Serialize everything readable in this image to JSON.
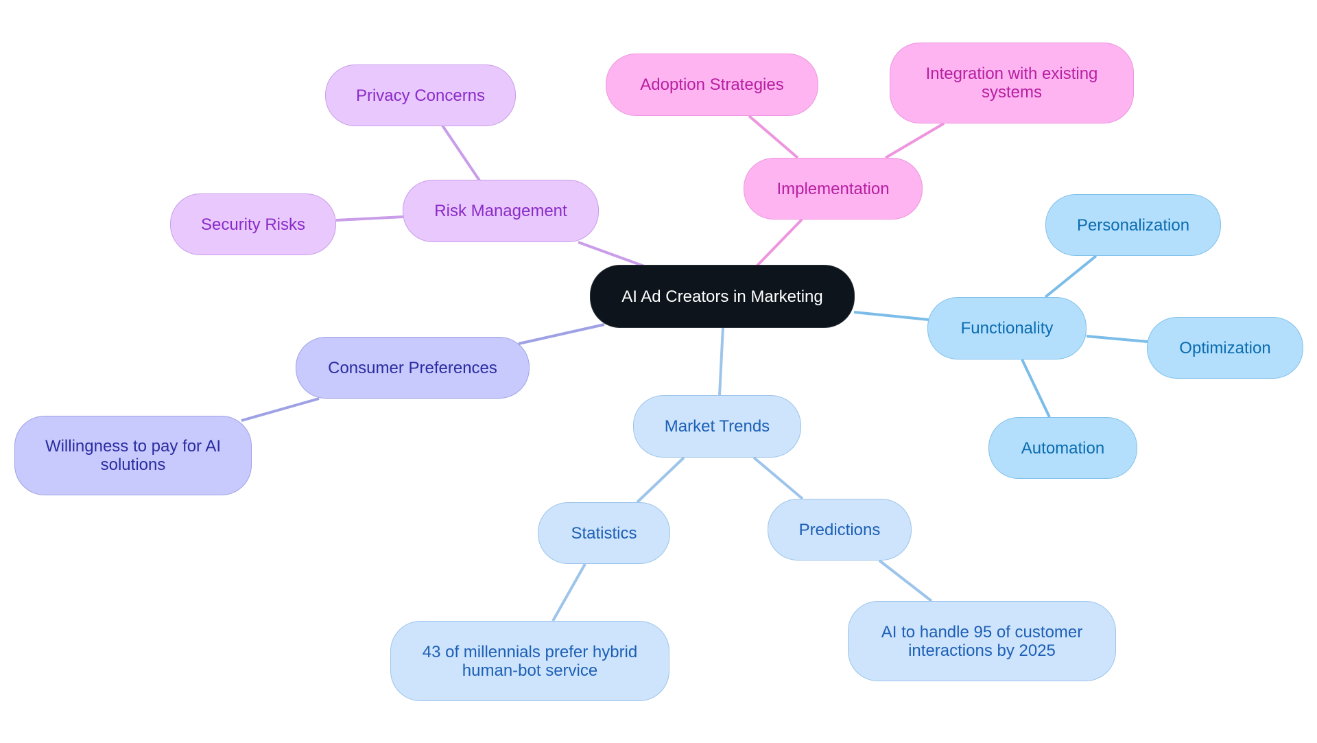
{
  "diagram": {
    "type": "mindmap",
    "root": "AI Ad Creators in Marketing",
    "colors": {
      "root_fill": "#0d141b",
      "risk_management": "#e8c8fd",
      "implementation": "#fdb4f1",
      "functionality": "#b3dffc",
      "market_trends": "#cde4fc",
      "consumer_preferences": "#c8cafd"
    },
    "nodes": {
      "root": "AI Ad Creators in Marketing",
      "risk_management": "Risk Management",
      "privacy_concerns": "Privacy Concerns",
      "security_risks": "Security Risks",
      "implementation": "Implementation",
      "adoption_strategies": "Adoption Strategies",
      "integration": "Integration with existing systems",
      "functionality": "Functionality",
      "personalization": "Personalization",
      "optimization": "Optimization",
      "automation": "Automation",
      "market_trends": "Market Trends",
      "statistics": "Statistics",
      "predictions": "Predictions",
      "stat_millennials": "43 of millennials prefer hybrid human-bot service",
      "prediction_ai": "AI to handle 95 of customer interactions by 2025",
      "consumer_preferences": "Consumer Preferences",
      "willingness": "Willingness to pay for AI solutions"
    },
    "edges": [
      [
        "root",
        "risk_management"
      ],
      [
        "root",
        "implementation"
      ],
      [
        "root",
        "functionality"
      ],
      [
        "root",
        "market_trends"
      ],
      [
        "root",
        "consumer_preferences"
      ],
      [
        "risk_management",
        "privacy_concerns"
      ],
      [
        "risk_management",
        "security_risks"
      ],
      [
        "implementation",
        "adoption_strategies"
      ],
      [
        "implementation",
        "integration"
      ],
      [
        "functionality",
        "personalization"
      ],
      [
        "functionality",
        "optimization"
      ],
      [
        "functionality",
        "automation"
      ],
      [
        "market_trends",
        "statistics"
      ],
      [
        "market_trends",
        "predictions"
      ],
      [
        "statistics",
        "stat_millennials"
      ],
      [
        "predictions",
        "prediction_ai"
      ],
      [
        "consumer_preferences",
        "willingness"
      ]
    ]
  }
}
